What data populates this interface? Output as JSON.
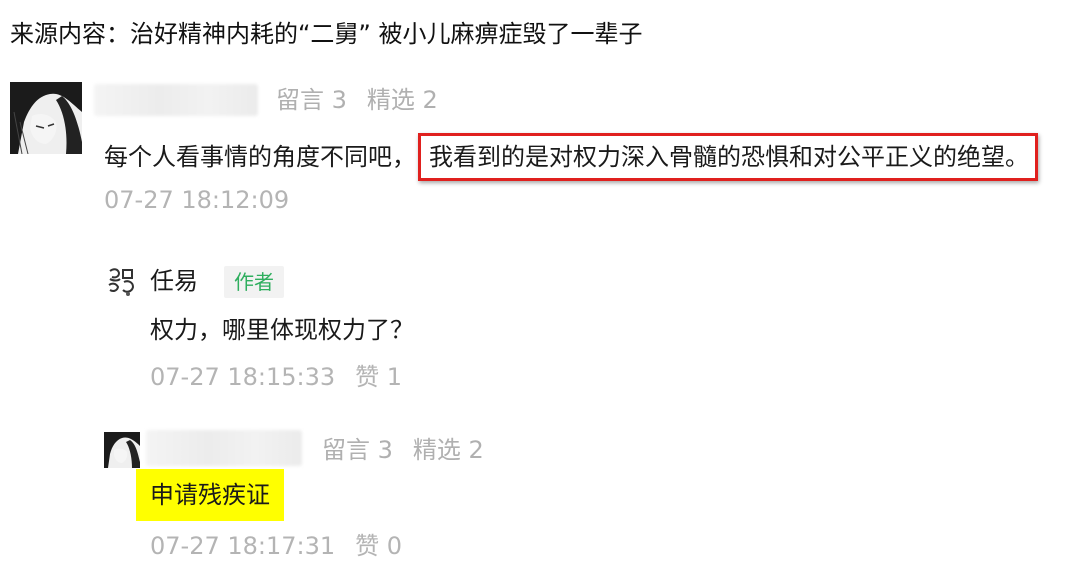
{
  "source": {
    "label": "来源内容：",
    "title": "治好精神内耗的“二舅” 被小儿麻痹症毁了一辈子"
  },
  "comment": {
    "author_name": "",
    "stats_comments": "留言 3",
    "stats_featured": "精选 2",
    "text_before": "每个人看事情的角度不同吧，",
    "text_highlighted": "我看到的是对权力深入骨髓的恐惧和对公平正义的绝望。",
    "time": "07-27 18:12:09",
    "highlight_color": "#e0201e"
  },
  "replies": [
    {
      "author_name": "任易",
      "tag": "作者",
      "text": "权力，哪里体现权力了？",
      "time": "07-27 18:15:33",
      "likes": "赞 1",
      "tag_color": "#2fae5e"
    },
    {
      "author_name": "",
      "stats_comments": "留言 3",
      "stats_featured": "精选 2",
      "text": "申请残疾证",
      "time": "07-27 18:17:31",
      "likes": "赞 0",
      "highlight_color": "#ffff00"
    }
  ]
}
